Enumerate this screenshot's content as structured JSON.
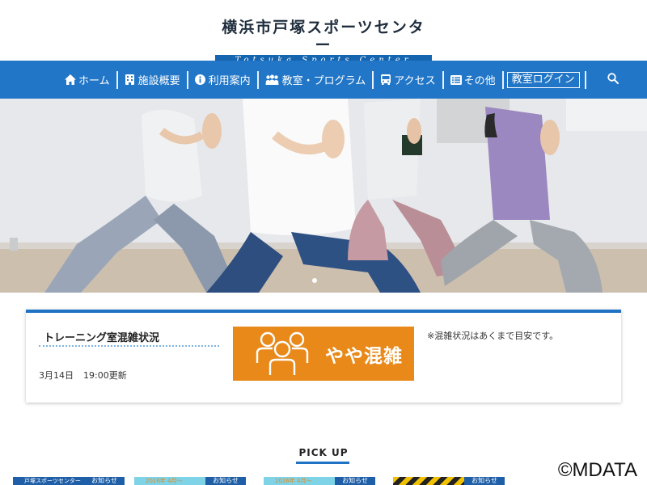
{
  "header": {
    "logo_jp": "横浜市戸塚スポーツセンター",
    "logo_en": "Totsuka Sports Center"
  },
  "nav": {
    "items": [
      {
        "label": "ホーム",
        "icon": "home-icon"
      },
      {
        "label": "施設概要",
        "icon": "building-icon"
      },
      {
        "label": "利用案内",
        "icon": "info-icon"
      },
      {
        "label": "教室・プログラム",
        "icon": "people-icon"
      },
      {
        "label": "アクセス",
        "icon": "bus-icon"
      },
      {
        "label": "その他",
        "icon": "list-icon"
      }
    ],
    "login_label": "教室ログイン",
    "search_icon": "search-icon"
  },
  "hero": {
    "image": "yoga-class-lunge-pose",
    "slide_dots": 1
  },
  "congestion": {
    "title": "トレーニング室混雑状況",
    "date": "3月14日",
    "time_updated": "19:00更新",
    "level": "やや混雑",
    "note": "※混雑状況はあくまで目安です。",
    "level_color": "#e8891a"
  },
  "pickup": {
    "title": "PICK UP",
    "cards": [
      {
        "thumb_text": "戸塚スポーツセンター",
        "tag": "お知らせ",
        "thumb_color": "#1f5fa8"
      },
      {
        "thumb_text": "2026年 4月～",
        "tag": "お知らせ",
        "thumb_color": "#7fd3e6"
      },
      {
        "thumb_text": "2026年 4月～",
        "tag": "お知らせ",
        "thumb_color": "#7fd3e6"
      },
      {
        "thumb_text": "",
        "tag": "お知らせ",
        "thumb_color": "#f2c200"
      }
    ]
  },
  "watermark": "©MDATA",
  "colors": {
    "nav_bg": "#2176c7",
    "accent": "#1f72c4"
  }
}
